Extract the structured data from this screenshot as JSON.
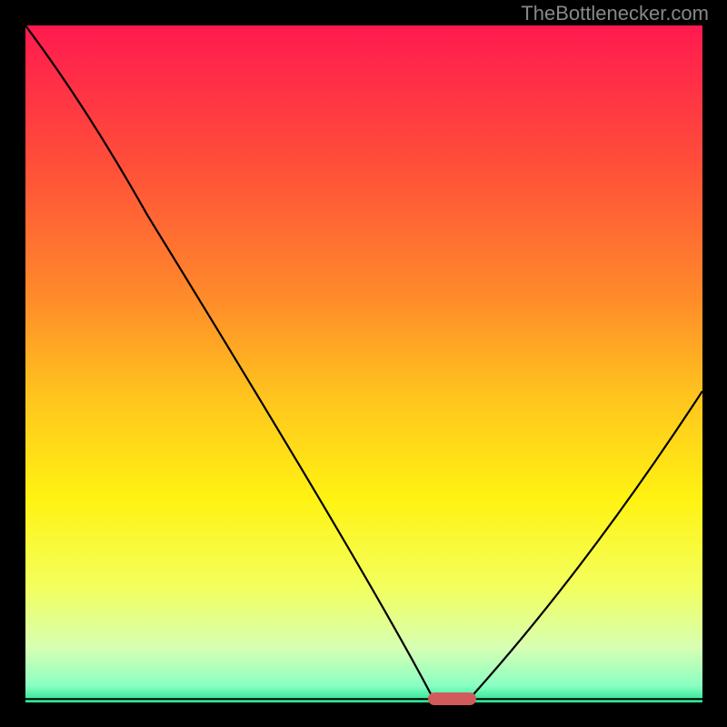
{
  "watermark": "TheBottlenecker.com",
  "chart_data": {
    "type": "line",
    "title": "",
    "xlabel": "",
    "ylabel": "",
    "ylim": [
      0,
      100
    ],
    "xlim": [
      0,
      100
    ],
    "x": [
      0,
      18,
      60,
      66,
      100
    ],
    "values": [
      100,
      72,
      1,
      1,
      46
    ],
    "marker": {
      "x_start": 60,
      "x_end": 66,
      "y": 0.5
    },
    "gradient_stops": [
      {
        "pos": 0.0,
        "color": "#ff1a4f"
      },
      {
        "pos": 0.2,
        "color": "#ff4d3a"
      },
      {
        "pos": 0.4,
        "color": "#ff8a2a"
      },
      {
        "pos": 0.55,
        "color": "#ffc51e"
      },
      {
        "pos": 0.7,
        "color": "#fff312"
      },
      {
        "pos": 0.83,
        "color": "#f3ff5e"
      },
      {
        "pos": 0.92,
        "color": "#d6ffb3"
      },
      {
        "pos": 0.975,
        "color": "#8affc3"
      },
      {
        "pos": 1.0,
        "color": "#24e38e"
      }
    ]
  }
}
